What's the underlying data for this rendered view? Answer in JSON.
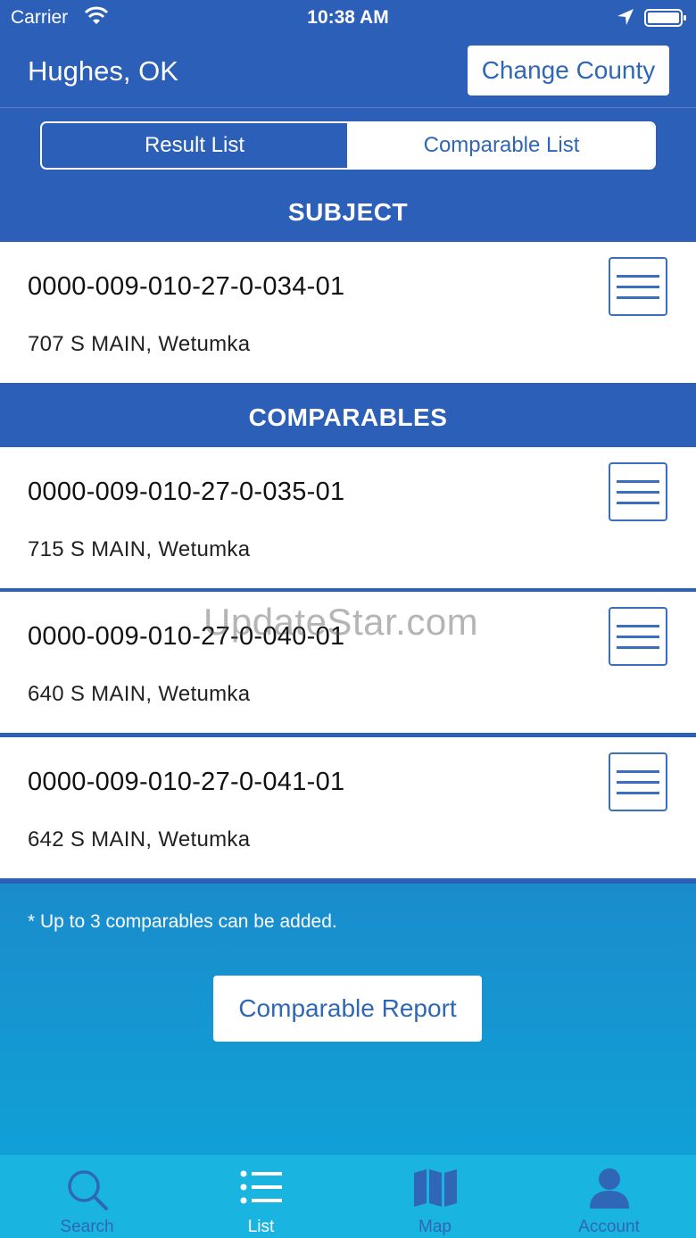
{
  "status_bar": {
    "carrier": "Carrier",
    "time": "10:38 AM"
  },
  "header": {
    "county": "Hughes, OK",
    "change_county_label": "Change County"
  },
  "segments": {
    "result_list": "Result List",
    "comparable_list": "Comparable List"
  },
  "subject": {
    "heading": "SUBJECT",
    "item": {
      "parcel": "0000-009-010-27-0-034-01",
      "address": "707 S MAIN, Wetumka"
    }
  },
  "comparables": {
    "heading": "COMPARABLES",
    "items": [
      {
        "parcel": "0000-009-010-27-0-035-01",
        "address": "715 S MAIN, Wetumka"
      },
      {
        "parcel": "0000-009-010-27-0-040-01",
        "address": "640 S MAIN, Wetumka"
      },
      {
        "parcel": "0000-009-010-27-0-041-01",
        "address": "642 S MAIN, Wetumka"
      }
    ]
  },
  "footer": {
    "note": "* Up to 3 comparables can be added.",
    "report_button": "Comparable Report"
  },
  "watermark": "UpdateStar.com",
  "tabs": [
    {
      "label": "Search",
      "icon": "search-icon"
    },
    {
      "label": "List",
      "icon": "list-icon"
    },
    {
      "label": "Map",
      "icon": "map-icon"
    },
    {
      "label": "Account",
      "icon": "account-icon"
    }
  ],
  "colors": {
    "primary": "#2c5fb8",
    "accent": "#2f67b6",
    "tab_bar": "#1ab4e0"
  }
}
